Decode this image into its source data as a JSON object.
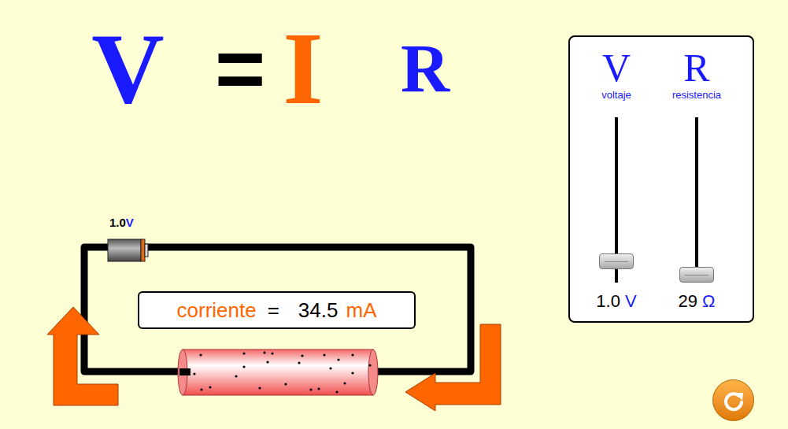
{
  "equation": {
    "left": "V",
    "equals": "=",
    "current": "I",
    "resistance": "R"
  },
  "panel": {
    "sliders": [
      {
        "symbol": "V",
        "label": "voltaje",
        "value": "1.0",
        "unit": "V",
        "level": 0.13
      },
      {
        "symbol": "R",
        "label": "resistencia",
        "value": "29",
        "unit": "Ω",
        "level": 0.05
      }
    ]
  },
  "circuit": {
    "battery": {
      "value": "1.0",
      "unit": "V"
    },
    "current": {
      "label": "corriente",
      "equals": "=",
      "value": "34.5",
      "unit": "mA"
    }
  }
}
